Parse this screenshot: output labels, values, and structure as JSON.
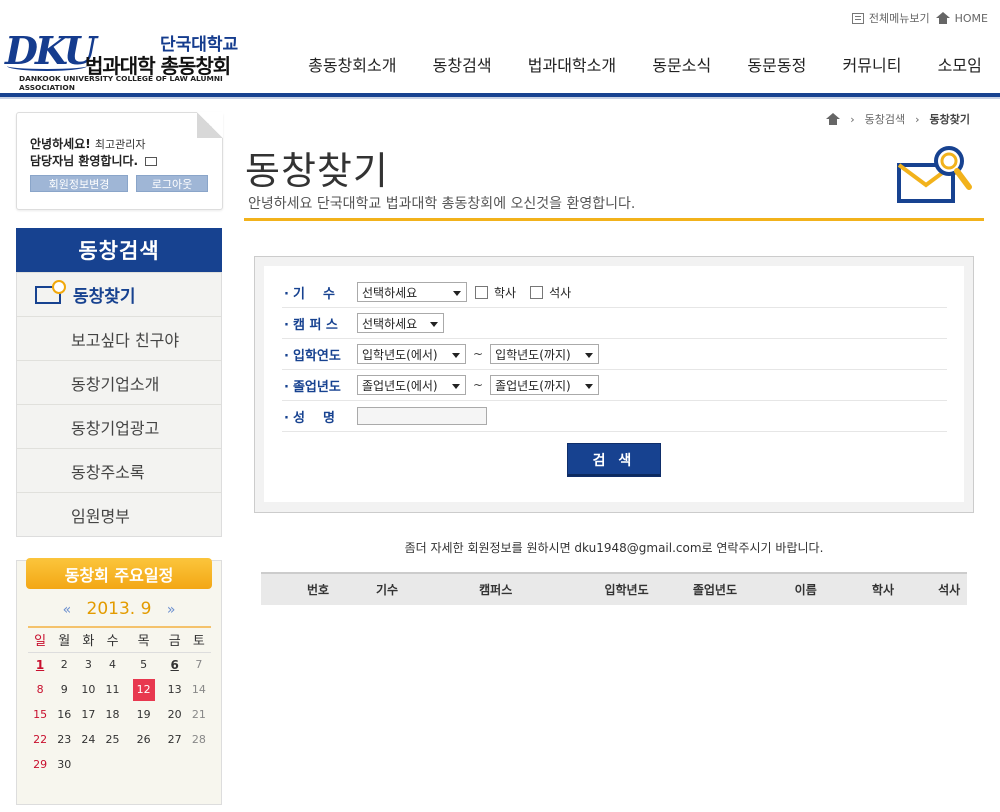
{
  "header": {
    "top_links": {
      "sitemap": "전체메뉴보기",
      "home": "HOME"
    },
    "logo": {
      "mark": "DKU",
      "university": "단국대학교",
      "title": "법과대학 총동창회",
      "english": "DANKOOK UNIVERSITY COLLEGE OF LAW ALUMNI ASSOCIATION"
    },
    "nav": [
      "총동창회소개",
      "동창검색",
      "법과대학소개",
      "동문소식",
      "동문동정",
      "커뮤니티",
      "소모임"
    ]
  },
  "login": {
    "greeting": "안녕하세요!",
    "user": "최고관리자",
    "line2": "담당자님 환영합니다.",
    "edit_button": "회원정보변경",
    "logout_button": "로그아웃"
  },
  "sidebar": {
    "title": "동창검색",
    "items": [
      "동창찾기",
      "보고싶다 친구야",
      "동창기업소개",
      "동창기업광고",
      "동창주소록",
      "임원명부"
    ]
  },
  "calendar": {
    "title": "동창회 주요일정",
    "month": "2013. 9",
    "prev": "«",
    "next": "»",
    "weekdays": [
      "일",
      "월",
      "화",
      "수",
      "목",
      "금",
      "토"
    ],
    "weeks": [
      [
        "1",
        "2",
        "3",
        "4",
        "5",
        "6",
        "7"
      ],
      [
        "8",
        "9",
        "10",
        "11",
        "12",
        "13",
        "14"
      ],
      [
        "15",
        "16",
        "17",
        "18",
        "19",
        "20",
        "21"
      ],
      [
        "22",
        "23",
        "24",
        "25",
        "26",
        "27",
        "28"
      ],
      [
        "29",
        "30",
        "",
        "",
        "",
        "",
        ""
      ]
    ],
    "events": [
      "1",
      "6"
    ],
    "today": "12"
  },
  "breadcrumb": {
    "section": "동창검색",
    "current": "동창찾기"
  },
  "page": {
    "title": "동창찾기",
    "subtitle": "안녕하세요 단국대학교 법과대학 총동창회에 오신것을 환영합니다."
  },
  "search": {
    "rows": [
      {
        "label": "기    수"
      },
      {
        "label": "캠 퍼 스"
      },
      {
        "label": "입학연도"
      },
      {
        "label": "졸업년도"
      },
      {
        "label": "성    명"
      }
    ],
    "gisu_select": "선택하세요",
    "bachelor": "학사",
    "master": "석사",
    "campus_select": "선택하세요",
    "admit_from": "입학년도(에서)",
    "admit_to": "입학년도(까지)",
    "grad_from": "졸업년도(에서)",
    "grad_to": "졸업년도(까지)",
    "tilde": "~",
    "name_value": "",
    "button": "검 색"
  },
  "notice": "좀더 자세한 회원정보를 원하시면 dku1948@gmail.com로 연락주시기 바랍니다.",
  "results": {
    "columns": [
      "번호",
      "기수",
      "캠퍼스",
      "입학년도",
      "졸업년도",
      "이름",
      "학사",
      "석사"
    ]
  },
  "colors": {
    "brand_blue": "#174290",
    "accent_gold": "#f2b21b",
    "today_red": "#e8384f"
  }
}
